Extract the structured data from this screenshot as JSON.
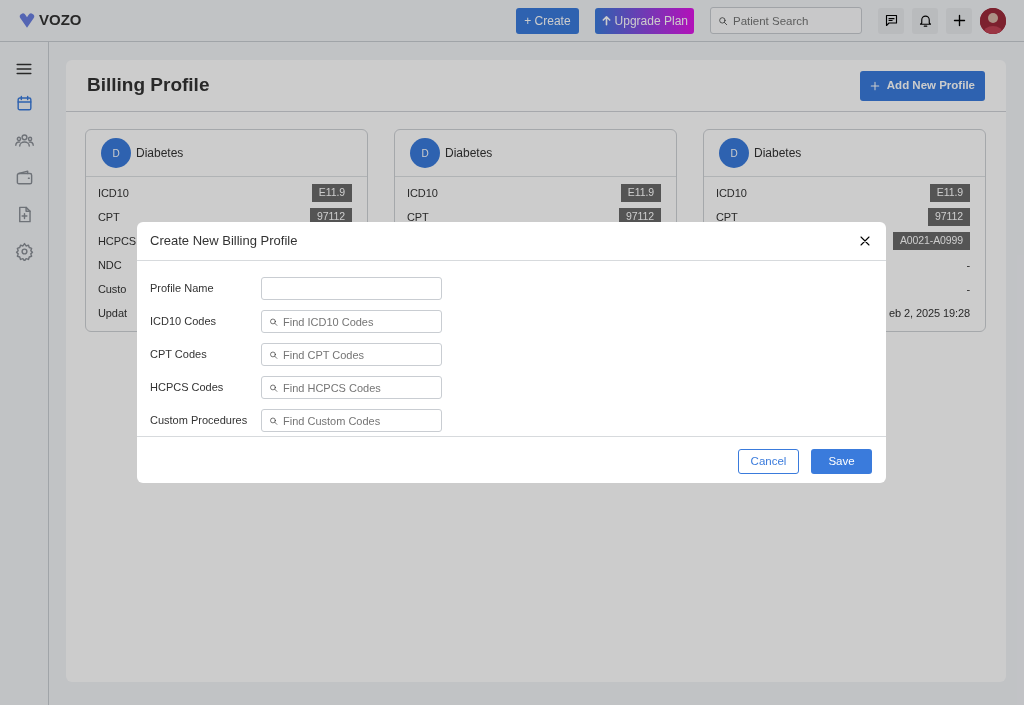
{
  "topbar": {
    "logo": "VOZO",
    "create": "+ Create",
    "upgrade": "Upgrade Plan",
    "search": {
      "placeholder": "Patient Search"
    }
  },
  "sidebar": {
    "items": [
      {
        "selected": true
      },
      {
        "selected": false
      },
      {
        "selected": false
      },
      {
        "selected": false
      },
      {
        "selected": false
      }
    ]
  },
  "page": {
    "title": "Billing Profile",
    "add_button": "Add New Profile"
  },
  "cards": [
    {
      "initial": "D",
      "name": "Diabetes",
      "rows": [
        {
          "label": "ICD10",
          "value": "E11.9",
          "kind": "code"
        },
        {
          "label": "CPT",
          "value": "97112",
          "kind": "code"
        },
        {
          "label": "HCPCS"
        },
        {
          "label": "NDC"
        },
        {
          "label": "Custo"
        },
        {
          "label": "Updat"
        }
      ]
    },
    {
      "initial": "D",
      "name": "Diabetes",
      "rows": [
        {
          "label": "ICD10",
          "value": "E11.9",
          "kind": "code"
        },
        {
          "label": "CPT",
          "value": "97112",
          "kind": "code"
        }
      ]
    },
    {
      "initial": "D",
      "name": "Diabetes",
      "rows": [
        {
          "label": "ICD10",
          "value": "E11.9",
          "kind": "code"
        },
        {
          "label": "CPT",
          "value": "97112",
          "kind": "code"
        },
        {
          "value": "A0021-A0999",
          "kind": "code"
        },
        {
          "value": "-",
          "kind": "text"
        },
        {
          "value": "-",
          "kind": "text"
        },
        {
          "value": "eb 2, 2025 19:28",
          "kind": "text"
        }
      ]
    }
  ],
  "modal": {
    "title": "Create New Billing Profile",
    "fields": [
      {
        "label": "Profile Name",
        "kind": "text"
      },
      {
        "label": "ICD10 Codes",
        "placeholder": "Find ICD10 Codes",
        "kind": "search"
      },
      {
        "label": "CPT Codes",
        "placeholder": "Find CPT Codes",
        "kind": "search"
      },
      {
        "label": "HCPCS Codes",
        "placeholder": "Find HCPCS Codes",
        "kind": "search"
      },
      {
        "label": "Custom Procedures",
        "placeholder": "Find Custom Codes",
        "kind": "search"
      }
    ],
    "cancel": "Cancel",
    "save": "Save"
  }
}
